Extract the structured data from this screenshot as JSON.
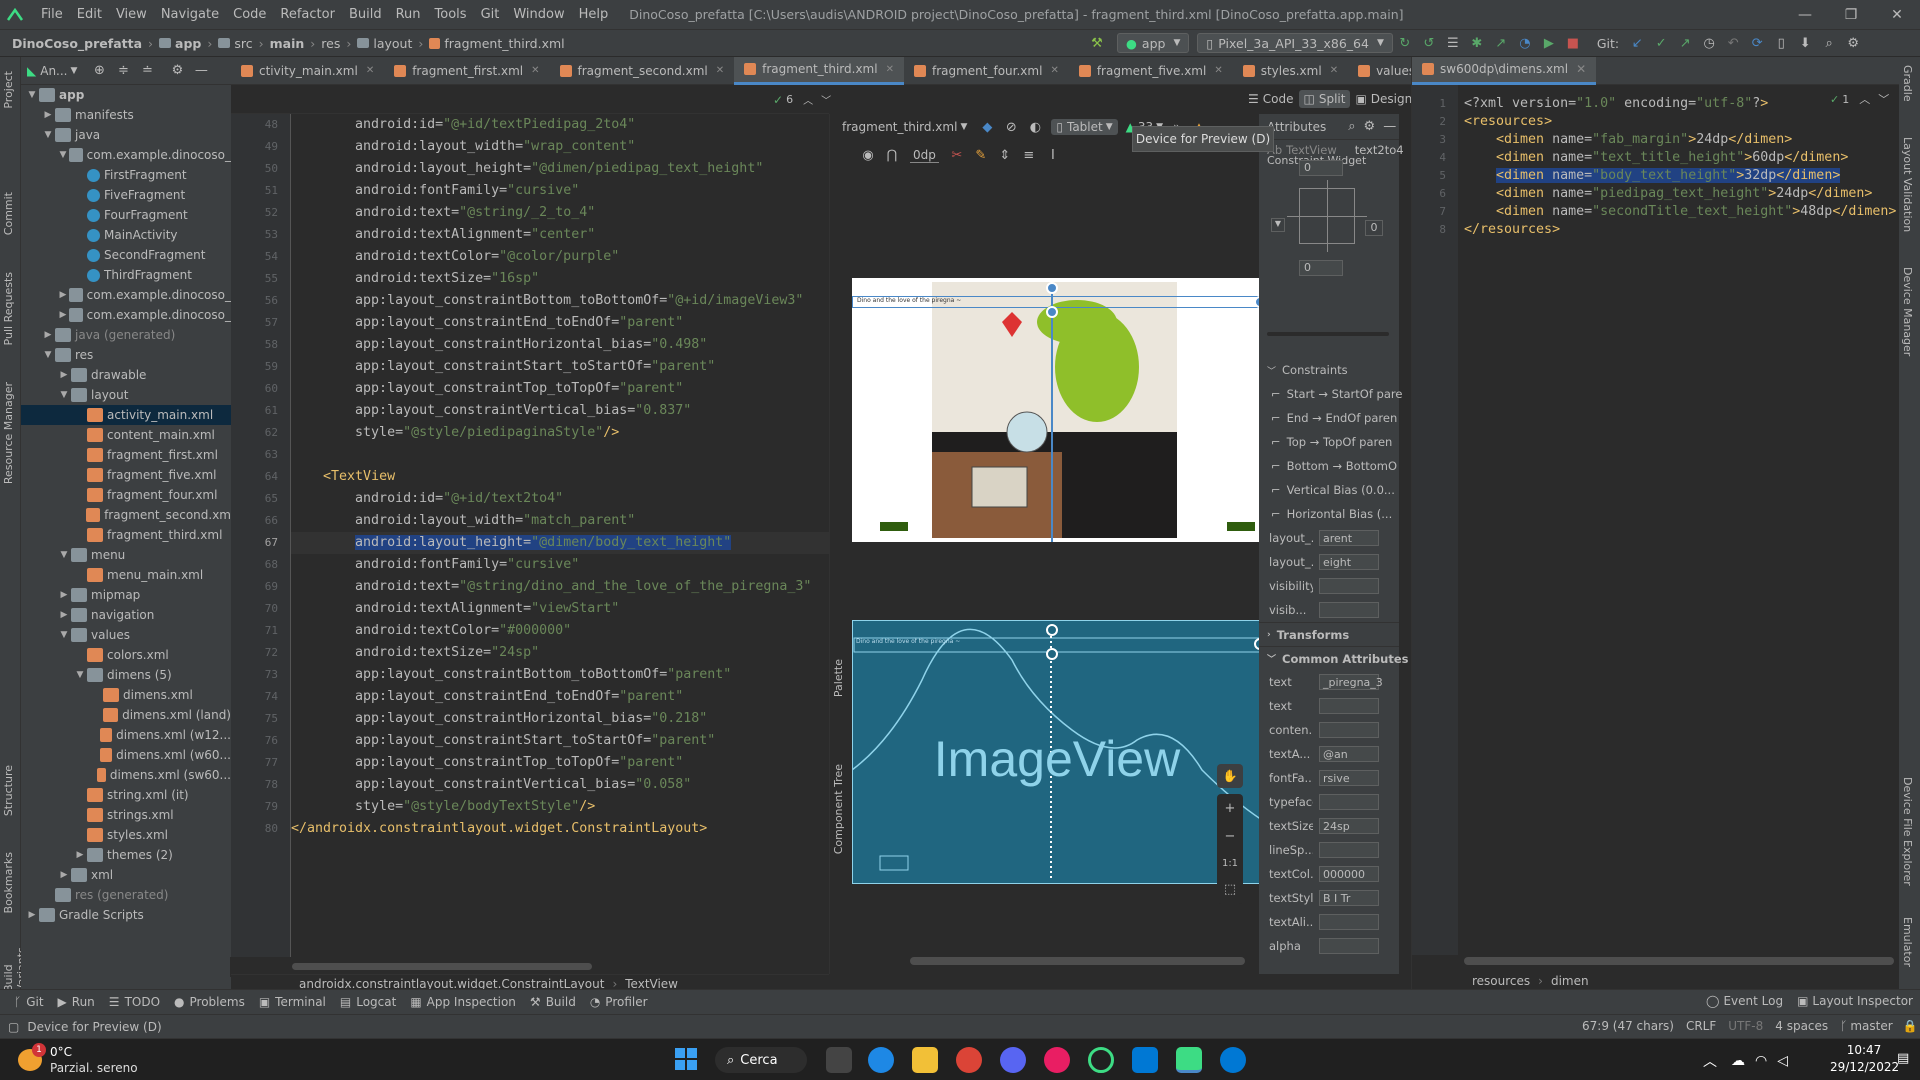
{
  "menubar": {
    "items": [
      "File",
      "Edit",
      "View",
      "Navigate",
      "Code",
      "Refactor",
      "Build",
      "Run",
      "Tools",
      "Git",
      "Window",
      "Help"
    ],
    "window_title": "DinoCoso_prefatta [C:\\Users\\audis\\ANDROID project\\DinoCoso_prefatta] - fragment_third.xml [DinoCoso_prefatta.app.main]"
  },
  "navbar": {
    "crumbs": [
      "DinoCoso_prefatta",
      "app",
      "src",
      "main",
      "res",
      "layout",
      "fragment_third.xml"
    ],
    "run_config": "app",
    "device": "Pixel_3a_API_33_x86_64",
    "git_label": "Git:"
  },
  "project": {
    "header": "An...",
    "tree": [
      {
        "label": "app",
        "indent": 0,
        "icon": "fold",
        "open": true,
        "bold": true
      },
      {
        "label": "manifests",
        "indent": 1,
        "icon": "fold",
        "open": false
      },
      {
        "label": "java",
        "indent": 1,
        "icon": "fold",
        "open": true
      },
      {
        "label": "com.example.dinocoso_",
        "indent": 2,
        "icon": "fold",
        "open": true
      },
      {
        "label": "FirstFragment",
        "indent": 3,
        "icon": "cls"
      },
      {
        "label": "FiveFragment",
        "indent": 3,
        "icon": "cls"
      },
      {
        "label": "FourFragment",
        "indent": 3,
        "icon": "cls"
      },
      {
        "label": "MainActivity",
        "indent": 3,
        "icon": "cls"
      },
      {
        "label": "SecondFragment",
        "indent": 3,
        "icon": "cls"
      },
      {
        "label": "ThirdFragment",
        "indent": 3,
        "icon": "cls"
      },
      {
        "label": "com.example.dinocoso_",
        "indent": 2,
        "icon": "fold",
        "open": false
      },
      {
        "label": "com.example.dinocoso_",
        "indent": 2,
        "icon": "fold",
        "open": false
      },
      {
        "label": "java (generated)",
        "indent": 1,
        "icon": "fold",
        "open": false,
        "dim": true
      },
      {
        "label": "res",
        "indent": 1,
        "icon": "fold",
        "open": true
      },
      {
        "label": "drawable",
        "indent": 2,
        "icon": "fold",
        "open": false
      },
      {
        "label": "layout",
        "indent": 2,
        "icon": "fold",
        "open": true
      },
      {
        "label": "activity_main.xml",
        "indent": 3,
        "icon": "xmlic",
        "selected": true
      },
      {
        "label": "content_main.xml",
        "indent": 3,
        "icon": "xmlic"
      },
      {
        "label": "fragment_first.xml",
        "indent": 3,
        "icon": "xmlic"
      },
      {
        "label": "fragment_five.xml",
        "indent": 3,
        "icon": "xmlic"
      },
      {
        "label": "fragment_four.xml",
        "indent": 3,
        "icon": "xmlic"
      },
      {
        "label": "fragment_second.xm",
        "indent": 3,
        "icon": "xmlic"
      },
      {
        "label": "fragment_third.xml",
        "indent": 3,
        "icon": "xmlic"
      },
      {
        "label": "menu",
        "indent": 2,
        "icon": "fold",
        "open": true
      },
      {
        "label": "menu_main.xml",
        "indent": 3,
        "icon": "xmlic"
      },
      {
        "label": "mipmap",
        "indent": 2,
        "icon": "fold",
        "open": false
      },
      {
        "label": "navigation",
        "indent": 2,
        "icon": "fold",
        "open": false
      },
      {
        "label": "values",
        "indent": 2,
        "icon": "fold",
        "open": true
      },
      {
        "label": "colors.xml",
        "indent": 3,
        "icon": "xmlic"
      },
      {
        "label": "dimens (5)",
        "indent": 3,
        "icon": "fold",
        "open": true
      },
      {
        "label": "dimens.xml",
        "indent": 4,
        "icon": "xmlic"
      },
      {
        "label": "dimens.xml (land)",
        "indent": 4,
        "icon": "xmlic"
      },
      {
        "label": "dimens.xml (w12...",
        "indent": 4,
        "icon": "xmlic"
      },
      {
        "label": "dimens.xml (w60...",
        "indent": 4,
        "icon": "xmlic"
      },
      {
        "label": "dimens.xml (sw60...",
        "indent": 4,
        "icon": "xmlic"
      },
      {
        "label": "string.xml (it)",
        "indent": 3,
        "icon": "xmlic"
      },
      {
        "label": "strings.xml",
        "indent": 3,
        "icon": "xmlic"
      },
      {
        "label": "styles.xml",
        "indent": 3,
        "icon": "xmlic"
      },
      {
        "label": "themes (2)",
        "indent": 3,
        "icon": "fold",
        "open": false
      },
      {
        "label": "xml",
        "indent": 2,
        "icon": "fold",
        "open": false
      },
      {
        "label": "res (generated)",
        "indent": 1,
        "icon": "fold",
        "dim": true
      },
      {
        "label": "Gradle Scripts",
        "indent": 0,
        "icon": "fold",
        "open": false
      }
    ]
  },
  "leftstrip": [
    "Project",
    "Commit",
    "Pull Requests",
    "Resource Manager",
    "Structure",
    "Bookmarks",
    "Build Variants"
  ],
  "rightstrip": [
    "Gradle",
    "Layout Validation",
    "Device Manager",
    "Device File Explorer",
    "Emulator"
  ],
  "tabs": [
    {
      "label": "ctivity_main.xml"
    },
    {
      "label": "fragment_first.xml"
    },
    {
      "label": "fragment_second.xml"
    },
    {
      "label": "fragment_third.xml",
      "active": true
    },
    {
      "label": "fragment_four.xml"
    },
    {
      "label": "fragment_five.xml"
    },
    {
      "label": "styles.xml"
    },
    {
      "label": "values\\dimens.xml"
    }
  ],
  "editor": {
    "inspection_count": "6",
    "current_line": 67,
    "lines": [
      {
        "n": 48,
        "text": "        android:id=\"@+id/textPiedipag_2to4\""
      },
      {
        "n": 49,
        "text": "        android:layout_width=\"wrap_content\""
      },
      {
        "n": 50,
        "text": "        android:layout_height=\"@dimen/piedipag_text_height\""
      },
      {
        "n": 51,
        "text": "        android:fontFamily=\"cursive\""
      },
      {
        "n": 52,
        "text": "        android:text=\"@string/_2_to_4\""
      },
      {
        "n": 53,
        "text": "        android:textAlignment=\"center\""
      },
      {
        "n": 54,
        "text": "        android:textColor=\"@color/purple\""
      },
      {
        "n": 55,
        "text": "        android:textSize=\"16sp\""
      },
      {
        "n": 56,
        "text": "        app:layout_constraintBottom_toBottomOf=\"@+id/imageView3\""
      },
      {
        "n": 57,
        "text": "        app:layout_constraintEnd_toEndOf=\"parent\""
      },
      {
        "n": 58,
        "text": "        app:layout_constraintHorizontal_bias=\"0.498\""
      },
      {
        "n": 59,
        "text": "        app:layout_constraintStart_toStartOf=\"parent\""
      },
      {
        "n": 60,
        "text": "        app:layout_constraintTop_toTopOf=\"parent\""
      },
      {
        "n": 61,
        "text": "        app:layout_constraintVertical_bias=\"0.837\""
      },
      {
        "n": 62,
        "text": "        style=\"@style/piedipaginaStyle\"/>"
      },
      {
        "n": 63,
        "text": ""
      },
      {
        "n": 64,
        "text": "    <TextView"
      },
      {
        "n": 65,
        "text": "        android:id=\"@+id/text2to4\""
      },
      {
        "n": 66,
        "text": "        android:layout_width=\"match_parent\""
      },
      {
        "n": 67,
        "text": "        android:layout_height=\"@dimen/body_text_height\""
      },
      {
        "n": 68,
        "text": "        android:fontFamily=\"cursive\""
      },
      {
        "n": 69,
        "text": "        android:text=\"@string/dino_and_the_love_of_the_piregna_3\""
      },
      {
        "n": 70,
        "text": "        android:textAlignment=\"viewStart\""
      },
      {
        "n": 71,
        "text": "        android:textColor=\"#000000\""
      },
      {
        "n": 72,
        "text": "        android:textSize=\"24sp\""
      },
      {
        "n": 73,
        "text": "        app:layout_constraintBottom_toBottomOf=\"parent\""
      },
      {
        "n": 74,
        "text": "        app:layout_constraintEnd_toEndOf=\"parent\""
      },
      {
        "n": 75,
        "text": "        app:layout_constraintHorizontal_bias=\"0.218\""
      },
      {
        "n": 76,
        "text": "        app:layout_constraintStart_toStartOf=\"parent\""
      },
      {
        "n": 77,
        "text": "        app:layout_constraintTop_toTopOf=\"parent\""
      },
      {
        "n": 78,
        "text": "        app:layout_constraintVertical_bias=\"0.058\""
      },
      {
        "n": 79,
        "text": "        style=\"@style/bodyTextStyle\"/>"
      },
      {
        "n": 80,
        "text": "</androidx.constraintlayout.widget.ConstraintLayout>"
      }
    ],
    "breadcrumb": [
      "androidx.constraintlayout.widget.ConstraintLayout",
      "TextView"
    ]
  },
  "viewmodes": {
    "code": "Code",
    "split": "Split",
    "design": "Design"
  },
  "preview": {
    "file_select": "fragment_third.xml",
    "device": "Tablet",
    "api": "33",
    "dp_label": "0dp",
    "tooltip": "Device for Preview (D)",
    "blueprint_label": "ImageView",
    "tiny_text": "Dino and the love of the piregna ~",
    "zoom_label": "1:1",
    "palette_tab": "Palette",
    "component_tree_tab": "Component Tree"
  },
  "attributes": {
    "title": "Attributes",
    "widget_type": "TextView",
    "widget_id": "text2to4",
    "constraint_widget_label": "Constraint Widget",
    "margin_values": [
      "0",
      "0",
      "0",
      "0"
    ],
    "constraints_title": "Constraints",
    "constraints": [
      "Start → StartOf pare",
      "End → EndOf paren",
      "Top → TopOf paren",
      "Bottom → BottomO",
      "Vertical Bias (0.0...",
      "Horizontal Bias (..."
    ],
    "layout_rows": [
      {
        "label": "layout_...",
        "value": "arent"
      },
      {
        "label": "layout_...",
        "value": "eight"
      },
      {
        "label": "visibility",
        "value": ""
      },
      {
        "label": "visib...",
        "value": ""
      }
    ],
    "transforms": "Transforms",
    "common": "Common Attributes",
    "common_rows": [
      {
        "label": "text",
        "value": "_piregna_3"
      },
      {
        "label": "text",
        "value": ""
      },
      {
        "label": "conten...",
        "value": ""
      },
      {
        "label": "textA...",
        "value": "@an"
      },
      {
        "label": "fontFa...",
        "value": "rsive"
      },
      {
        "label": "typeface",
        "value": ""
      },
      {
        "label": "textSize",
        "value": "24sp"
      },
      {
        "label": "lineSp...",
        "value": ""
      },
      {
        "label": "textCol...",
        "value": "000000"
      },
      {
        "label": "textStyle",
        "value": "B I Tr"
      },
      {
        "label": "textAli...",
        "value": ""
      },
      {
        "label": "alpha",
        "value": ""
      }
    ]
  },
  "rightfile": {
    "tab": "sw600dp\\dimens.xml",
    "inspection": "1",
    "lines": [
      {
        "n": 1,
        "text": "<?xml version=\"1.0\" encoding=\"utf-8\"?>"
      },
      {
        "n": 2,
        "text": "<resources>"
      },
      {
        "n": 3,
        "text": "    <dimen name=\"fab_margin\">24dp</dimen>"
      },
      {
        "n": 4,
        "text": "    <dimen name=\"text_title_height\">60dp</dimen>"
      },
      {
        "n": 5,
        "text": "    <dimen name=\"body_text_height\">32dp</dimen>",
        "hl": true
      },
      {
        "n": 6,
        "text": "    <dimen name=\"piedipag_text_height\">24dp</dimen>"
      },
      {
        "n": 7,
        "text": "    <dimen name=\"secondTitle_text_height\">48dp</dimen>"
      },
      {
        "n": 8,
        "text": "</resources>"
      }
    ],
    "breadcrumb": [
      "resources",
      "dimen"
    ]
  },
  "bottomtabs": [
    "Git",
    "Run",
    "TODO",
    "Problems",
    "Terminal",
    "Logcat",
    "App Inspection",
    "Build",
    "Profiler"
  ],
  "bottomright": [
    "Event Log",
    "Layout Inspector"
  ],
  "statusbar": {
    "left": "Device for Preview (D)",
    "pos": "67:9 (47 chars)",
    "crlf": "CRLF",
    "enc": "UTF-8",
    "indent": "4 spaces",
    "branch": "master"
  },
  "taskbar": {
    "weather_temp": "0°C",
    "weather_desc": "Parzial. sereno",
    "search": "Cerca",
    "time": "10:47",
    "date": "29/12/2022",
    "notif": "1"
  }
}
